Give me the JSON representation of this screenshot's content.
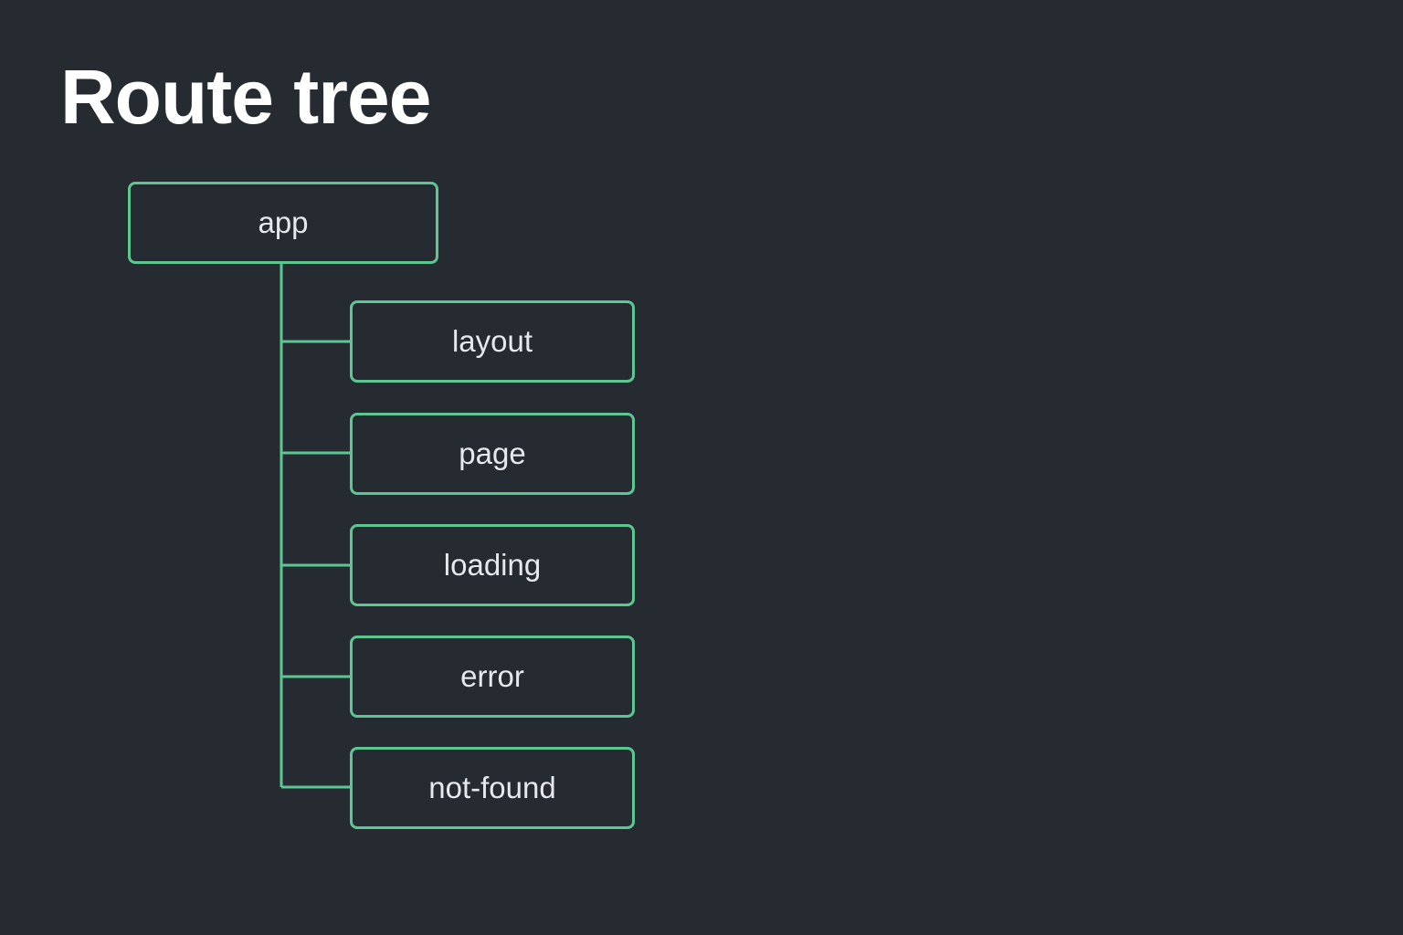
{
  "title": "Route tree",
  "colors": {
    "background": "#262a31",
    "accent": "#5cc792",
    "text": "#e6e8eb"
  },
  "tree": {
    "root": {
      "label": "app"
    },
    "children": [
      {
        "label": "layout"
      },
      {
        "label": "page"
      },
      {
        "label": "loading"
      },
      {
        "label": "error"
      },
      {
        "label": "not-found"
      }
    ]
  }
}
